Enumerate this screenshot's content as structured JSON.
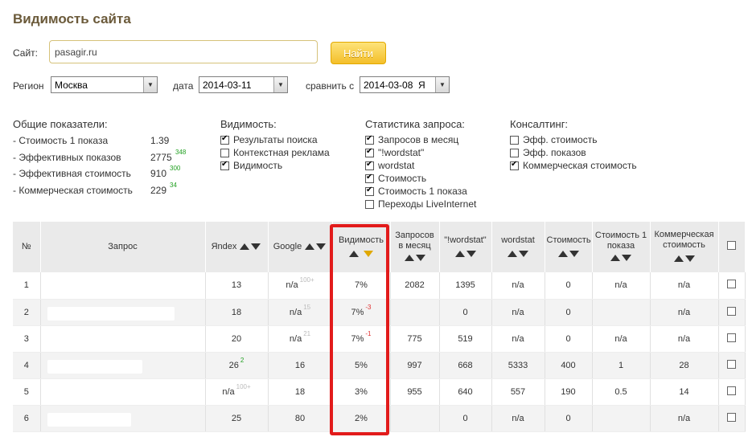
{
  "page": {
    "title": "Видимость сайта"
  },
  "site": {
    "label": "Сайт:",
    "value": "pasagir.ru",
    "button": "Найти"
  },
  "filters": {
    "region_label": "Регион",
    "region_value": "Москва",
    "date_label": "дата",
    "date_value": "2014-03-11",
    "compare_label": "сравнить с",
    "compare_value": "2014-03-08  Я"
  },
  "general": {
    "title": "Общие показатели:",
    "rows": [
      {
        "label": "- Стоимость 1 показа",
        "value": "1.39",
        "delta": ""
      },
      {
        "label": "- Эффективных показов",
        "value": "2775",
        "delta": "348"
      },
      {
        "label": "- Эффективная стоимость",
        "value": "910",
        "delta": "300"
      },
      {
        "label": "- Коммерческая стоимость",
        "value": "229",
        "delta": "34"
      }
    ]
  },
  "visibility": {
    "title": "Видимость:",
    "options": [
      {
        "label": "Результаты поиска",
        "checked": true
      },
      {
        "label": "Контекстная реклама",
        "checked": false
      },
      {
        "label": "Видимость",
        "checked": true
      }
    ]
  },
  "query_stats": {
    "title": "Статистика запроса:",
    "options": [
      {
        "label": "Запросов в месяц",
        "checked": true
      },
      {
        "label": "\"!wordstat\"",
        "checked": true
      },
      {
        "label": "wordstat",
        "checked": true
      },
      {
        "label": "Стоимость",
        "checked": true
      },
      {
        "label": "Стоимость 1 показа",
        "checked": true
      },
      {
        "label": "Переходы LiveInternet",
        "checked": false
      }
    ]
  },
  "consulting": {
    "title": "Консалтинг:",
    "options": [
      {
        "label": "Эфф. стоимость",
        "checked": false
      },
      {
        "label": "Эфф. показов",
        "checked": false
      },
      {
        "label": "Коммерческая стоимость",
        "checked": true
      }
    ]
  },
  "table": {
    "headers": {
      "num": "№",
      "query": "Запрос",
      "yandex": "Яndex",
      "google": "Google",
      "visibility": "Видимость",
      "requests": "Запросов в месяц",
      "wordstat_q": "\"!wordstat\"",
      "wordstat": "wordstat",
      "cost": "Стоимость",
      "cost1": "Стоимость 1 показа",
      "commercial": "Коммерческая стоимость"
    },
    "rows": [
      {
        "n": "1",
        "yandex": "13",
        "yandex_sup": "",
        "google": "n/a",
        "google_sup": "100+",
        "vis": "7%",
        "vis_sup": "",
        "req": "2082",
        "wq": "1395",
        "ws": "n/a",
        "cost": "0",
        "cost1": "n/a",
        "comm": "n/a"
      },
      {
        "n": "2",
        "yandex": "18",
        "yandex_sup": "",
        "google": "n/a",
        "google_sup": "15",
        "vis": "7%",
        "vis_sup": "-3",
        "req": "",
        "wq": "0",
        "ws": "n/a",
        "cost": "0",
        "cost1": "",
        "comm": "n/a"
      },
      {
        "n": "3",
        "yandex": "20",
        "yandex_sup": "",
        "google": "n/a",
        "google_sup": "21",
        "vis": "7%",
        "vis_sup": "-1",
        "req": "775",
        "wq": "519",
        "ws": "n/a",
        "cost": "0",
        "cost1": "n/a",
        "comm": "n/a"
      },
      {
        "n": "4",
        "yandex": "26",
        "yandex_sup": "2",
        "google": "16",
        "google_sup": "",
        "vis": "5%",
        "vis_sup": "",
        "req": "997",
        "wq": "668",
        "ws": "5333",
        "cost": "400",
        "cost1": "1",
        "comm": "28"
      },
      {
        "n": "5",
        "yandex": "n/a",
        "yandex_sup": "100+",
        "google": "18",
        "google_sup": "",
        "vis": "3%",
        "vis_sup": "",
        "req": "955",
        "wq": "640",
        "ws": "557",
        "cost": "190",
        "cost1": "0.5",
        "comm": "14"
      },
      {
        "n": "6",
        "yandex": "25",
        "yandex_sup": "",
        "google": "80",
        "google_sup": "",
        "vis": "2%",
        "vis_sup": "",
        "req": "",
        "wq": "0",
        "ws": "n/a",
        "cost": "0",
        "cost1": "",
        "comm": "n/a"
      }
    ]
  },
  "colors": {
    "highlight": "#e21b1b",
    "button": "#f4bf2a",
    "delta_positive": "#22a022",
    "delta_negative": "#e03030"
  }
}
